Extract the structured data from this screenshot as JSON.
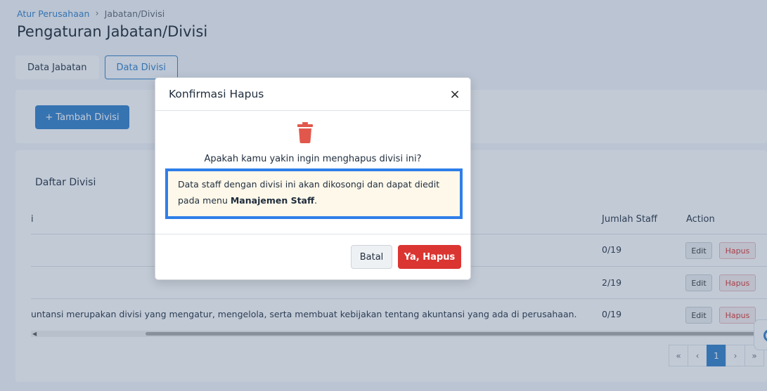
{
  "breadcrumb": {
    "parent": "Atur Perusahaan",
    "separator": "›",
    "current": "Jabatan/Divisi"
  },
  "page_title": "Pengaturan Jabatan/Divisi",
  "tabs": [
    {
      "label": "Data Jabatan",
      "active": false
    },
    {
      "label": "Data Divisi",
      "active": true
    }
  ],
  "add_button": "+ Tambah Divisi",
  "list_title": "Daftar Divisi",
  "table": {
    "headers": {
      "name_partial": "i",
      "staff": "Jumlah Staff",
      "action": "Action"
    },
    "rows": [
      {
        "description": "",
        "staff": "0/19",
        "edit": "Edit",
        "delete": "Hapus"
      },
      {
        "description": "",
        "staff": "2/19",
        "edit": "Edit",
        "delete": "Hapus"
      },
      {
        "description": "untansi merupakan divisi yang mengatur, mengelola, serta membuat kebijakan tentang akuntansi yang ada di perusahaan.",
        "staff": "0/19",
        "edit": "Edit",
        "delete": "Hapus"
      }
    ]
  },
  "pagination": {
    "first": "«",
    "prev": "‹",
    "current": "1",
    "next": "›",
    "last": "»"
  },
  "modal": {
    "title": "Konfirmasi Hapus",
    "close": "×",
    "question": "Apakah kamu yakin ingin menghapus divisi ini?",
    "warning_text": "Data staff dengan divisi ini akan dikosongi dan dapat diedit pada menu ",
    "warning_bold": "Manajemen Staff",
    "warning_end": ".",
    "cancel": "Batal",
    "confirm": "Ya, Hapus"
  },
  "colors": {
    "primary": "#2f7ec8",
    "danger": "#db3532",
    "warning_bg": "#fef8ea",
    "highlight_border": "#2f7ee8"
  },
  "icons": {
    "trash": "trash-icon",
    "close": "close-icon",
    "help": "help-icon"
  }
}
